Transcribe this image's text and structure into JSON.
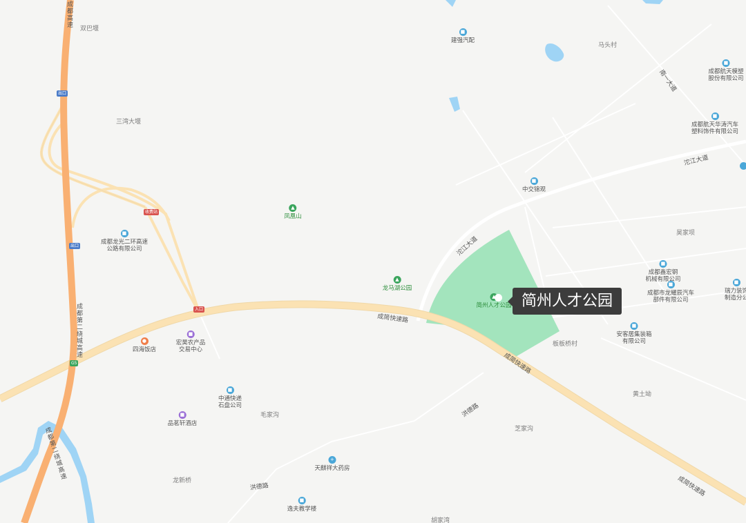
{
  "colors": {
    "background": "#f5f5f3",
    "park": "#a3e4bd",
    "water": "#9fd4f5",
    "expressway": "#f9b072",
    "road": "#fbe2b3",
    "minor_road": "#ffffff",
    "callout_bg": "#3c3c3c",
    "pin_blue": "#4aa7d8",
    "pin_green": "#3ba55d",
    "pin_purple": "#9b6fd6",
    "pin_orange": "#f07e4a"
  },
  "selected_place": "简州人才公园",
  "road_labels": {
    "chengjian_1": "成简快速路",
    "chengjian_2": "成简快速路",
    "chengjian_3": "成简快速路",
    "tuojiang_1": "沱江大道",
    "tuojiang_2": "沱江大道",
    "nanyi": "南一大道",
    "hongde_1": "洪德路",
    "hongde_2": "洪德路",
    "ring_1": "成都第二绕城高速",
    "ring_2": "成都第二绕城高速",
    "ring_3": "成都高速"
  },
  "place_labels": {
    "shuangba": "双巴堰",
    "sanwan": "三湾大堰",
    "matou": "马头村",
    "haojia": "昊家坝",
    "banbanqiao": "板板桥村",
    "huangtu": "黄土坳",
    "zhijia": "芝家沟",
    "maojia": "毛家沟",
    "longxinqiao": "龙新桥",
    "hujia": "胡家湾"
  },
  "shields": {
    "exit_1": "出口",
    "exit_2": "出口",
    "toll": "收费站",
    "entrance": "入口",
    "ring_code": "G5"
  },
  "pois": {
    "jianqiang": "建强汽配",
    "hangtian_model": "成都航天模塑\n股份有限公司",
    "hangtian_huatao": "成都航天华涛汽车\n塑料饰件有限公司",
    "zhongjiao": "中交锦观",
    "fenghuang": "凤凰山",
    "longguang": "成都龙光二环高速\n公路有限公司",
    "longmahu": "龙马湖公园",
    "jianzhou_park": "简州人才公园",
    "xinhong": "成都鑫宏钢\n机械有限公司",
    "longyao": "成都市龙耀辰汽车\n部件有限公司",
    "ruili": "瑞力装饰\n制造分公",
    "anke": "安客居集装箱\n有限公司",
    "hongrui": "宏昊农产品\n交易中心",
    "sihai": "四海饭店",
    "zhongtong": "中通快递\n石盘公司",
    "pinmingxuan": "品茗轩酒店",
    "tianqixiang": "天麒祥大药房",
    "yifu": "逸夫教学楼"
  }
}
